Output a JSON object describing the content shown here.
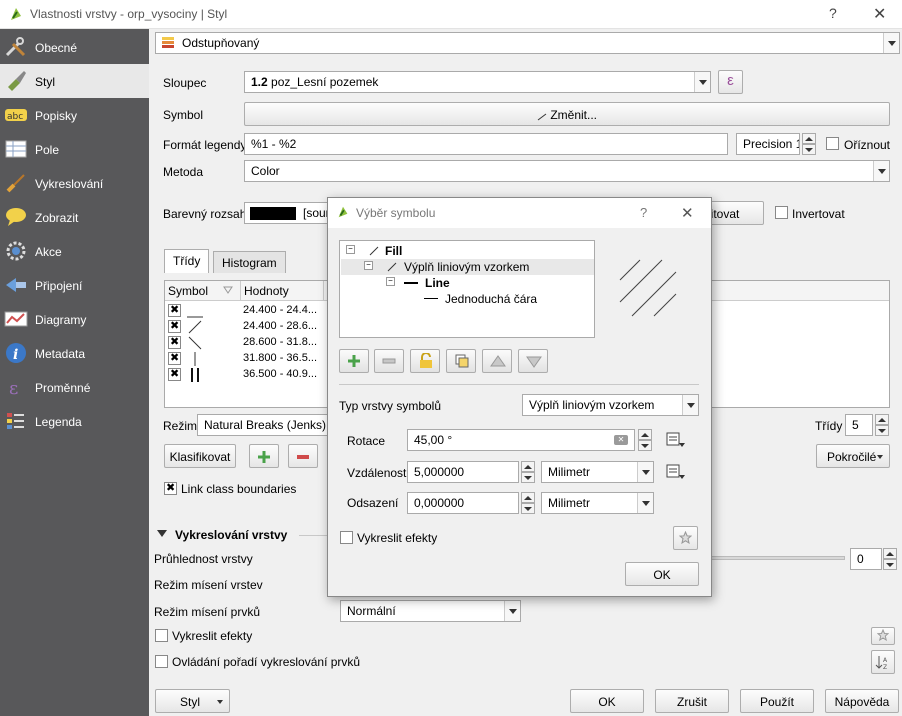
{
  "window": {
    "title": "Vlastnosti vrstvy - orp_vysociny | Styl",
    "help_glyph": "?",
    "close_glyph": "✕"
  },
  "sidebar": {
    "items": [
      {
        "label": "Obecné",
        "icon": "tools-icon"
      },
      {
        "label": "Styl",
        "icon": "brush-style-icon"
      },
      {
        "label": "Popisky",
        "icon": "abc-labels-icon"
      },
      {
        "label": "Pole",
        "icon": "table-fields-icon"
      },
      {
        "label": "Vykreslování",
        "icon": "paintbrush-icon"
      },
      {
        "label": "Zobrazit",
        "icon": "speech-bubble-icon"
      },
      {
        "label": "Akce",
        "icon": "gear-action-icon"
      },
      {
        "label": "Připojení",
        "icon": "join-icon"
      },
      {
        "label": "Diagramy",
        "icon": "diagram-icon"
      },
      {
        "label": "Metadata",
        "icon": "info-icon"
      },
      {
        "label": "Proměnné",
        "icon": "variable-icon"
      },
      {
        "label": "Legenda",
        "icon": "legend-icon"
      }
    ]
  },
  "style": {
    "renderer": "Odstupňovaný",
    "column_label": "Sloupec",
    "column_value_prefix": "1.2",
    "column_value": "poz_Lesní pozemek",
    "expression_glyph": "ε",
    "symbol_label": "Symbol",
    "change_button": "Změnit...",
    "legend_format_label": "Formát legendy",
    "legend_format_value": "%1 - %2",
    "precision_value": "Precision 1",
    "trim_label": "Oříznout",
    "method_label": "Metoda",
    "method_value": "Color",
    "color_ramp_label": "Barevný rozsah",
    "color_ramp_value": "[sour",
    "edit_button": "Editovat",
    "invert_label": "Invertovat",
    "tabs": [
      "Třídy",
      "Histogram"
    ],
    "table_headers": [
      "Symbol",
      "Hodnoty"
    ],
    "rows": [
      {
        "value": "24.400 - 24.4..."
      },
      {
        "value": "24.400 - 28.6..."
      },
      {
        "value": "28.600 - 31.8..."
      },
      {
        "value": "31.800 - 36.5..."
      },
      {
        "value": "36.500 - 40.9..."
      }
    ],
    "mode_label": "Režim",
    "mode_value": "Natural Breaks (Jenks)",
    "classes_label": "Třídy",
    "classes_value": "5",
    "classify_button": "Klasifikovat",
    "advanced_button": "Pokročilé",
    "link_boundaries_label": "Link class boundaries"
  },
  "rendering": {
    "section_title": "Vykreslování vrstvy",
    "opacity_label": "Průhlednost vrstvy",
    "opacity_value": "0",
    "layer_blend_label": "Režim mísení vrstev",
    "feature_blend_label": "Režim mísení prvků",
    "feature_blend_value": "Normální",
    "draw_effects_label": "Vykreslit efekty",
    "order_label": "Ovládání pořadí vykreslování prvků"
  },
  "footer": {
    "style_button": "Styl",
    "ok": "OK",
    "cancel": "Zrušit",
    "apply": "Použít",
    "help": "Nápověda"
  },
  "dialog": {
    "title": "Výběr symbolu",
    "help_glyph": "?",
    "close_glyph": "✕",
    "tree": [
      "Fill",
      "Výplň liniovým vzorkem",
      "Line",
      "Jednoduchá čára"
    ],
    "layer_type_label": "Typ vrstvy symbolů",
    "layer_type_value": "Výplň liniovým vzorkem",
    "rotation_label": "Rotace",
    "rotation_value": "45,00 °",
    "spacing_label": "Vzdálenost",
    "spacing_value": "5,000000",
    "spacing_unit": "Milimetr",
    "offset_label": "Odsazení",
    "offset_value": "0,000000",
    "offset_unit": "Milimetr",
    "draw_effects_label": "Vykreslit efekty",
    "ok": "OK"
  }
}
